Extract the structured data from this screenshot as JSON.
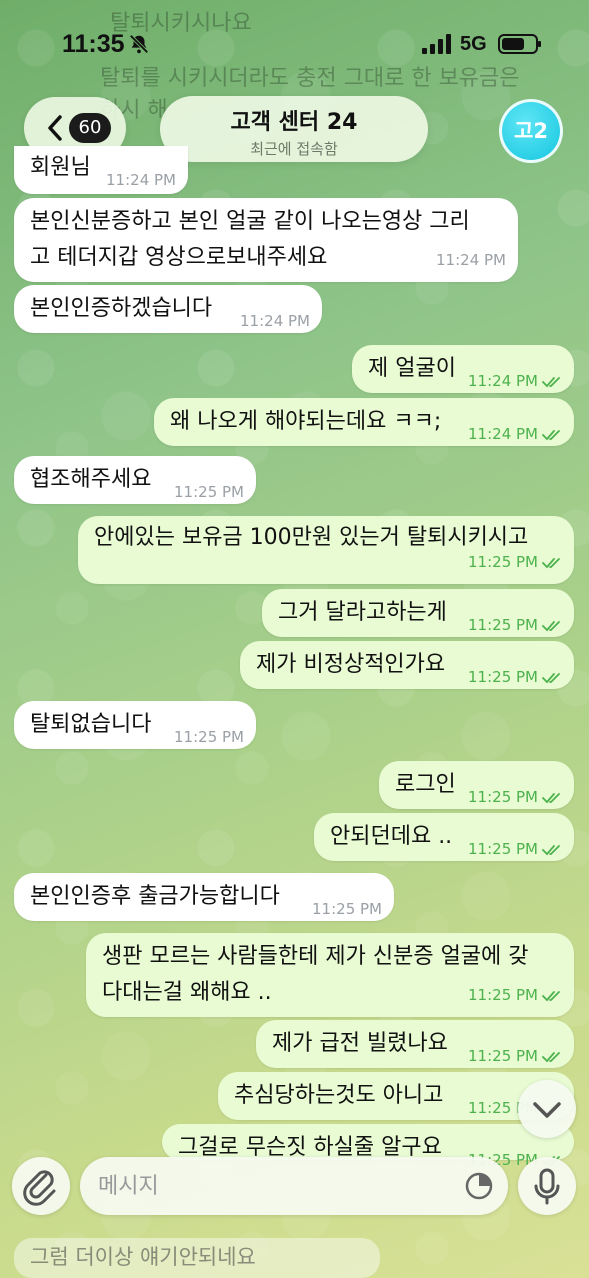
{
  "status_bar": {
    "time": "11:35",
    "network": "5G"
  },
  "ghost_top": {
    "line1": "탈퇴시키시나요",
    "line2": "탈퇴를 시키시더라도 충전 그대로 한 보유금은",
    "line3": "하시 해"
  },
  "header": {
    "back_count": "60",
    "title": "고객 센터 24",
    "subtitle": "최근에 접속함",
    "avatar_text": "고2"
  },
  "messages": [
    {
      "dir": "in",
      "lines": [
        "회원님"
      ],
      "time": "11:24 PM"
    },
    {
      "dir": "in",
      "lines": [
        "본인신분증하고 본인 얼굴 같이 나오는영상 그리",
        "고 테더지갑 영상으로보내주세요"
      ],
      "time": "11:24 PM"
    },
    {
      "dir": "in",
      "lines": [
        "본인인증하겠습니다"
      ],
      "time": "11:24 PM"
    },
    {
      "dir": "out",
      "lines": [
        "제 얼굴이"
      ],
      "time": "11:24 PM"
    },
    {
      "dir": "out",
      "lines": [
        "왜 나오게 해야되는데요 ㅋㅋ;"
      ],
      "time": "11:24 PM"
    },
    {
      "dir": "in",
      "lines": [
        "협조해주세요"
      ],
      "time": "11:25 PM"
    },
    {
      "dir": "out",
      "lines": [
        "안에있는 보유금 100만원 있는거 탈퇴시키시고"
      ],
      "time": "11:25 PM"
    },
    {
      "dir": "out",
      "lines": [
        "그거 달라고하는게"
      ],
      "time": "11:25 PM"
    },
    {
      "dir": "out",
      "lines": [
        "제가 비정상적인가요"
      ],
      "time": "11:25 PM"
    },
    {
      "dir": "in",
      "lines": [
        "탈퇴없습니다"
      ],
      "time": "11:25 PM"
    },
    {
      "dir": "out",
      "lines": [
        "로그인"
      ],
      "time": "11:25 PM"
    },
    {
      "dir": "out",
      "lines": [
        "안되던데요 .."
      ],
      "time": "11:25 PM"
    },
    {
      "dir": "in",
      "lines": [
        "본인인증후 출금가능합니다"
      ],
      "time": "11:25 PM"
    },
    {
      "dir": "out",
      "lines": [
        "생판 모르는 사람들한테 제가 신분증 얼굴에 갖",
        "다대는걸 왜해요 .."
      ],
      "time": "11:25 PM"
    },
    {
      "dir": "out",
      "lines": [
        "제가 급전 빌렸나요"
      ],
      "time": "11:25 PM"
    },
    {
      "dir": "out",
      "lines": [
        "추심당하는것도 아니고"
      ],
      "time": "11:25 PM"
    },
    {
      "dir": "out",
      "lines": [
        "그걸로 무슨짓 하실줄 알구요"
      ],
      "time": "11:25 PM"
    }
  ],
  "input": {
    "placeholder": "메시지"
  },
  "bottom_ghost": "그럼 더이상 얘기안되네요"
}
